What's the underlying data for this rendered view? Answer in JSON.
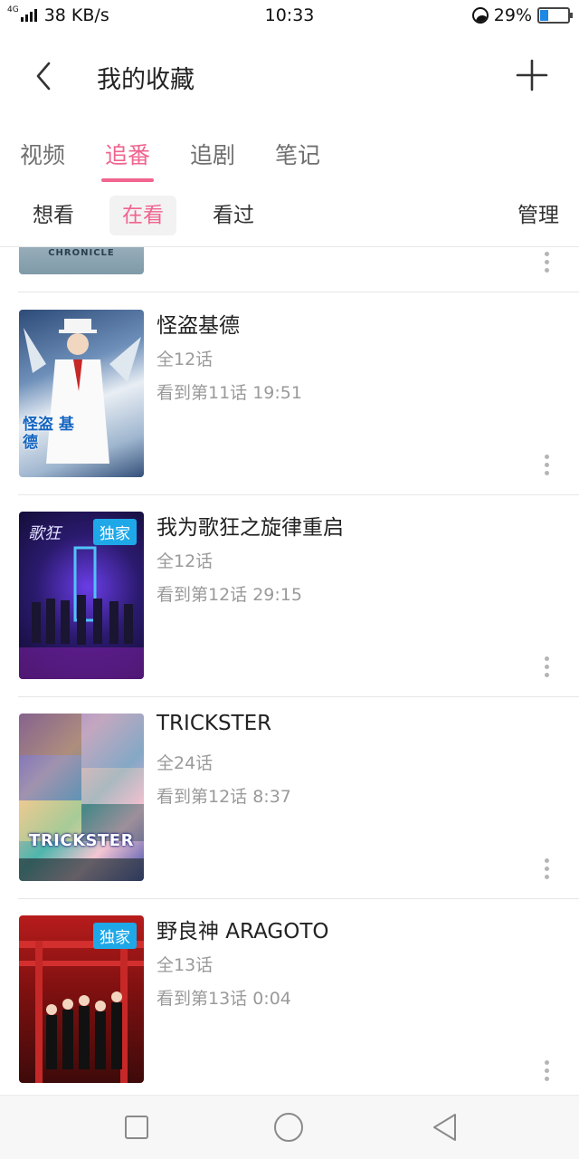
{
  "status_bar": {
    "network_type": "4G",
    "speed": "38 KB/s",
    "time": "10:33",
    "battery_percent": "29%",
    "battery_level": 0.29
  },
  "header": {
    "title": "我的收藏",
    "back_icon": "chevron-left-icon",
    "add_icon": "plus-icon"
  },
  "main_tabs": [
    {
      "label": "视频",
      "active": false
    },
    {
      "label": "追番",
      "active": true
    },
    {
      "label": "追剧",
      "active": false
    },
    {
      "label": "笔记",
      "active": false
    }
  ],
  "sub_tabs": [
    {
      "label": "想看",
      "active": false
    },
    {
      "label": "在看",
      "active": true
    },
    {
      "label": "看过",
      "active": false
    }
  ],
  "manage_label": "管理",
  "partial_item": {
    "thumb_text": "CHRONICLE"
  },
  "items": [
    {
      "title": "怪盗基德",
      "episodes": "全12话",
      "progress": "看到第11话 19:51",
      "badge": "",
      "thumb_text": "怪盗 基德"
    },
    {
      "title": "我为歌狂之旋律重启",
      "episodes": "全12话",
      "progress": "看到第12话 29:15",
      "badge": "独家",
      "thumb_text": ""
    },
    {
      "title": "TRICKSTER",
      "episodes": "全24话",
      "progress": "看到第12话 8:37",
      "badge": "",
      "thumb_text": "TRICKSTER"
    },
    {
      "title": "野良神 ARAGOTO",
      "episodes": "全13话",
      "progress": "看到第13话 0:04",
      "badge": "独家",
      "thumb_text": ""
    }
  ],
  "nav_bar": {
    "recent_icon": "square-icon",
    "home_icon": "circle-icon",
    "back_icon": "triangle-back-icon"
  },
  "colors": {
    "accent": "#f0648f",
    "badge": "#1ea8e8",
    "secondary_text": "#9a9a9a"
  }
}
